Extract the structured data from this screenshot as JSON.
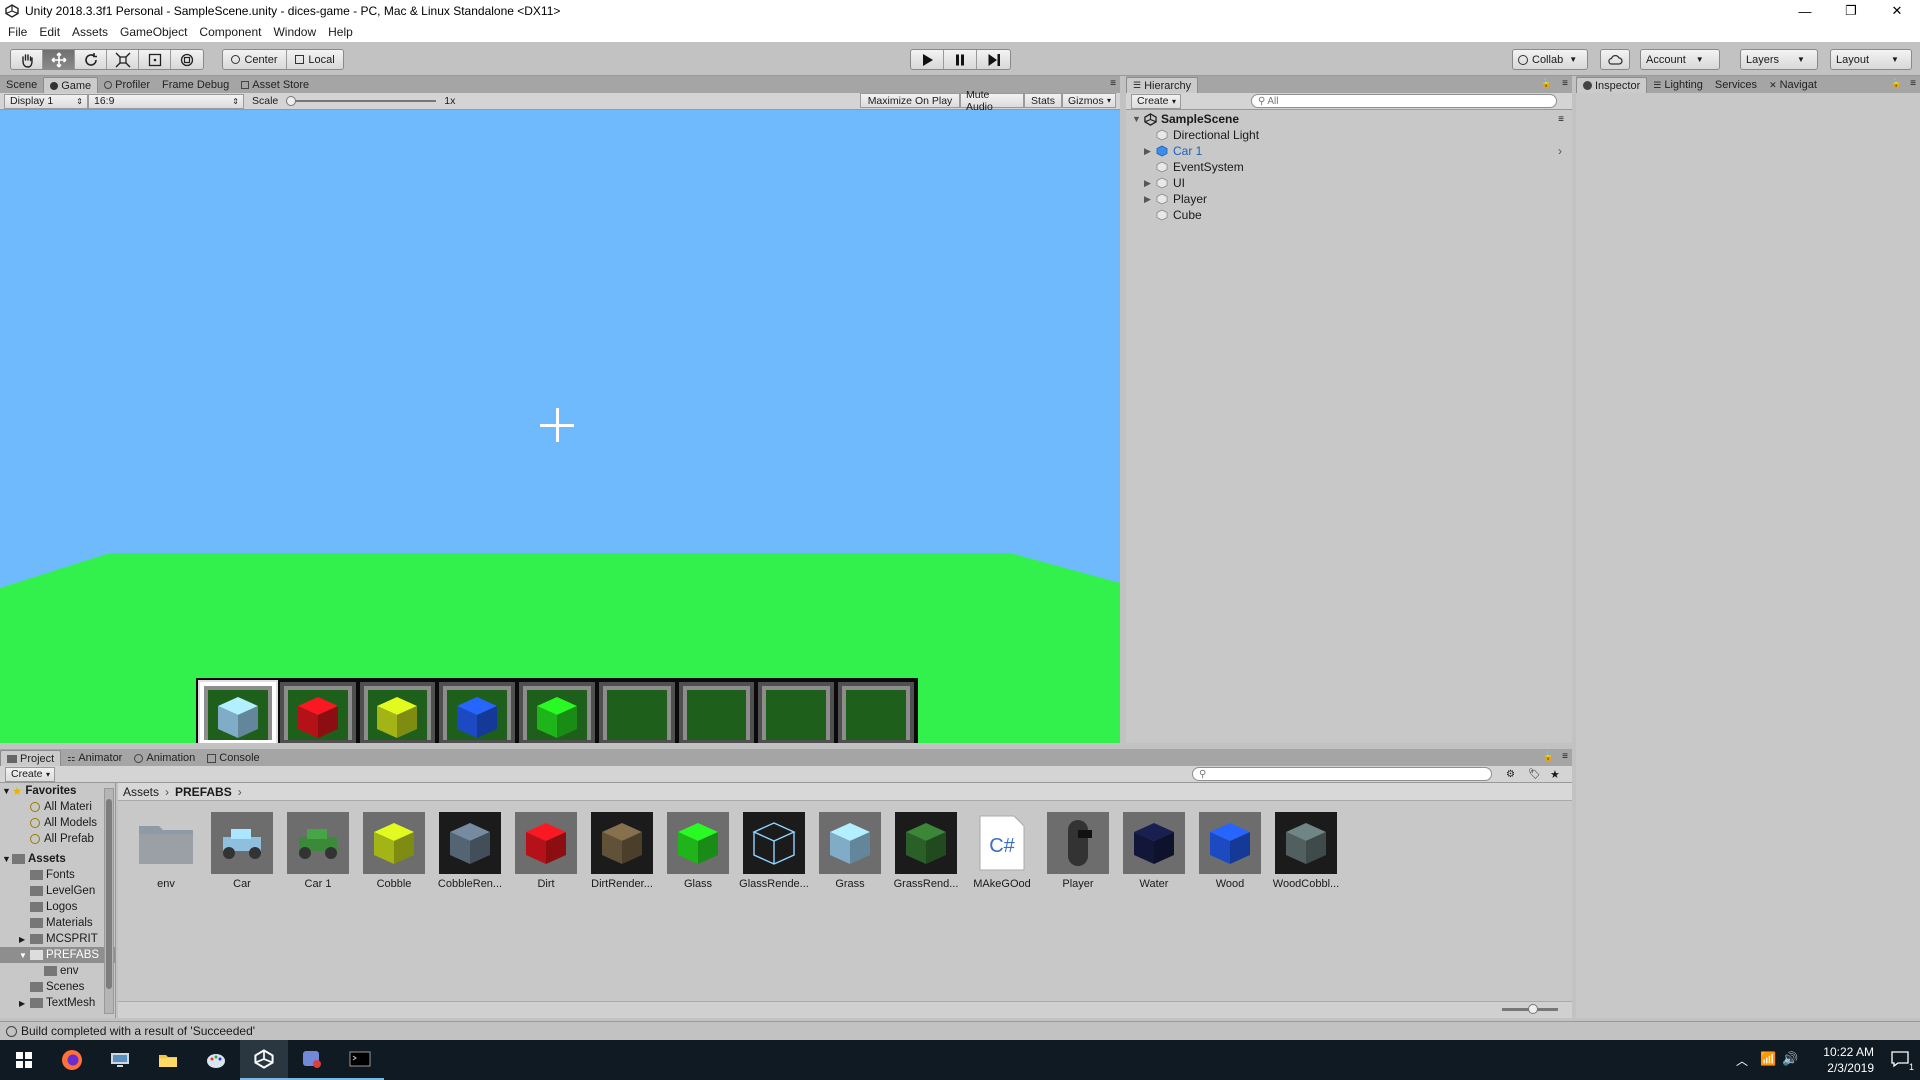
{
  "window": {
    "title": "Unity 2018.3.3f1 Personal - SampleScene.unity - dices-game - PC, Mac & Linux Standalone <DX11>",
    "minimize": "—",
    "restore": "❐",
    "close": "✕"
  },
  "menu": [
    "File",
    "Edit",
    "Assets",
    "GameObject",
    "Component",
    "Window",
    "Help"
  ],
  "toolbar": {
    "pivot_label": "Center",
    "space_label": "Local",
    "collab_label": "Collab",
    "account_label": "Account",
    "layers_label": "Layers",
    "layout_label": "Layout",
    "active_tool": "move"
  },
  "tabs": {
    "left": [
      "Scene",
      "Game",
      "Profiler",
      "Frame Debug",
      "Asset Store"
    ],
    "active_left": "Game",
    "hierarchy": "Hierarchy",
    "inspector": [
      "Inspector",
      "Lighting",
      "Services",
      "Navigat"
    ],
    "bottom": [
      "Project",
      "Animator",
      "Animation",
      "Console"
    ]
  },
  "game_bar": {
    "display": "Display 1",
    "aspect": "16:9",
    "scale_label": "Scale",
    "scale_value": "1x",
    "maximize": "Maximize On Play",
    "mute": "Mute Audio",
    "stats": "Stats",
    "gizmos": "Gizmos"
  },
  "game": {
    "sky_color": "#6fb9fd",
    "ground_color": "#33f14d",
    "hotbar_selected": 0,
    "hotbar": [
      {
        "block": "Grass",
        "color": "#8fbfde"
      },
      {
        "block": "Dirt",
        "color": "#c8141b"
      },
      {
        "block": "Cobble",
        "color": "#b5c81a"
      },
      {
        "block": "Wood",
        "color": "#1e52d8"
      },
      {
        "block": "Glass",
        "color": "#22c81c"
      },
      {
        "block": "",
        "color": ""
      },
      {
        "block": "",
        "color": ""
      },
      {
        "block": "",
        "color": ""
      },
      {
        "block": "",
        "color": ""
      }
    ]
  },
  "hierarchy": {
    "create": "Create",
    "search_placeholder": "All",
    "scene": "SampleScene",
    "items": [
      {
        "name": "Directional Light",
        "expandable": false,
        "prefab": false
      },
      {
        "name": "Car 1",
        "expandable": true,
        "prefab": true
      },
      {
        "name": "EventSystem",
        "expandable": false,
        "prefab": false
      },
      {
        "name": "UI",
        "expandable": true,
        "prefab": false
      },
      {
        "name": "Player",
        "expandable": true,
        "prefab": false
      },
      {
        "name": "Cube",
        "expandable": false,
        "prefab": false
      }
    ]
  },
  "project": {
    "create": "Create",
    "favorites_label": "Favorites",
    "favorites": [
      "All Materi",
      "All Models",
      "All Prefab"
    ],
    "assets_label": "Assets",
    "folders": [
      "Fonts",
      "LevelGen",
      "Logos",
      "Materials",
      "MCSPRIT",
      "PREFABS",
      "env",
      "Scenes",
      "TextMesh"
    ],
    "selected_folder": "PREFABS",
    "breadcrumb": [
      "Assets",
      "PREFABS"
    ],
    "items": [
      {
        "name": "env",
        "kind": "folder",
        "color": "#9aa0a6"
      },
      {
        "name": "Car",
        "kind": "car",
        "color": "#8fbfde"
      },
      {
        "name": "Car 1",
        "kind": "car",
        "color": "#3a8a3a"
      },
      {
        "name": "Cobble",
        "kind": "cube",
        "color": "#b5c81a"
      },
      {
        "name": "CobbleRen...",
        "kind": "texcube",
        "color": "#5e6f80"
      },
      {
        "name": "Dirt",
        "kind": "cube",
        "color": "#c8141b"
      },
      {
        "name": "DirtRender...",
        "kind": "texcube",
        "color": "#6b5a3e"
      },
      {
        "name": "Glass",
        "kind": "cube",
        "color": "#22c81c"
      },
      {
        "name": "GlassRende...",
        "kind": "glass",
        "color": "#8fd4ff"
      },
      {
        "name": "Grass",
        "kind": "cube",
        "color": "#8fbfde"
      },
      {
        "name": "GrassRend...",
        "kind": "texcube",
        "color": "#2f6b2c"
      },
      {
        "name": "MAkeGOod",
        "kind": "script",
        "color": "#ffffff"
      },
      {
        "name": "Player",
        "kind": "player",
        "color": "#333333"
      },
      {
        "name": "Water",
        "kind": "cube",
        "color": "#141a40"
      },
      {
        "name": "Wood",
        "kind": "cube",
        "color": "#1e52d8"
      },
      {
        "name": "WoodCobbl...",
        "kind": "texcube",
        "color": "#5a6a6a"
      }
    ]
  },
  "status": "Build completed with a result of 'Succeeded'",
  "taskbar": {
    "time": "10:22 AM",
    "date": "2/3/2019",
    "notif_count": "1"
  }
}
